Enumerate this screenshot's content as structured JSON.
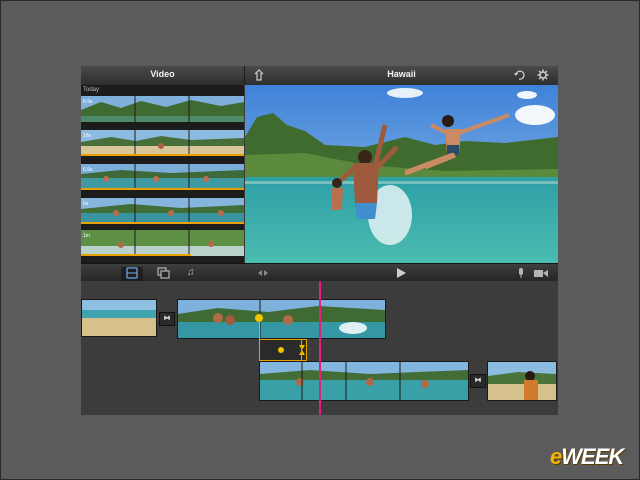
{
  "browser": {
    "title": "Video",
    "section": "Today",
    "clips": [
      {
        "duration": "6.9s"
      },
      {
        "duration": "16s"
      },
      {
        "duration": "6.9s"
      },
      {
        "duration": "6s"
      },
      {
        "duration": "1m"
      }
    ]
  },
  "viewer": {
    "title": "Hawaii"
  },
  "toolbar": {
    "video_icon": "film-icon",
    "photo_icon": "photos-icon",
    "audio_icon": "music-note-icon",
    "play_icon": "play-icon",
    "mic_icon": "microphone-icon",
    "camera_icon": "camera-icon"
  },
  "colors": {
    "accent": "#e8a100",
    "playhead": "#e0207a",
    "active_tab": "#6fa6e8"
  },
  "watermark": {
    "prefix": "e",
    "rest": "WEEK"
  }
}
